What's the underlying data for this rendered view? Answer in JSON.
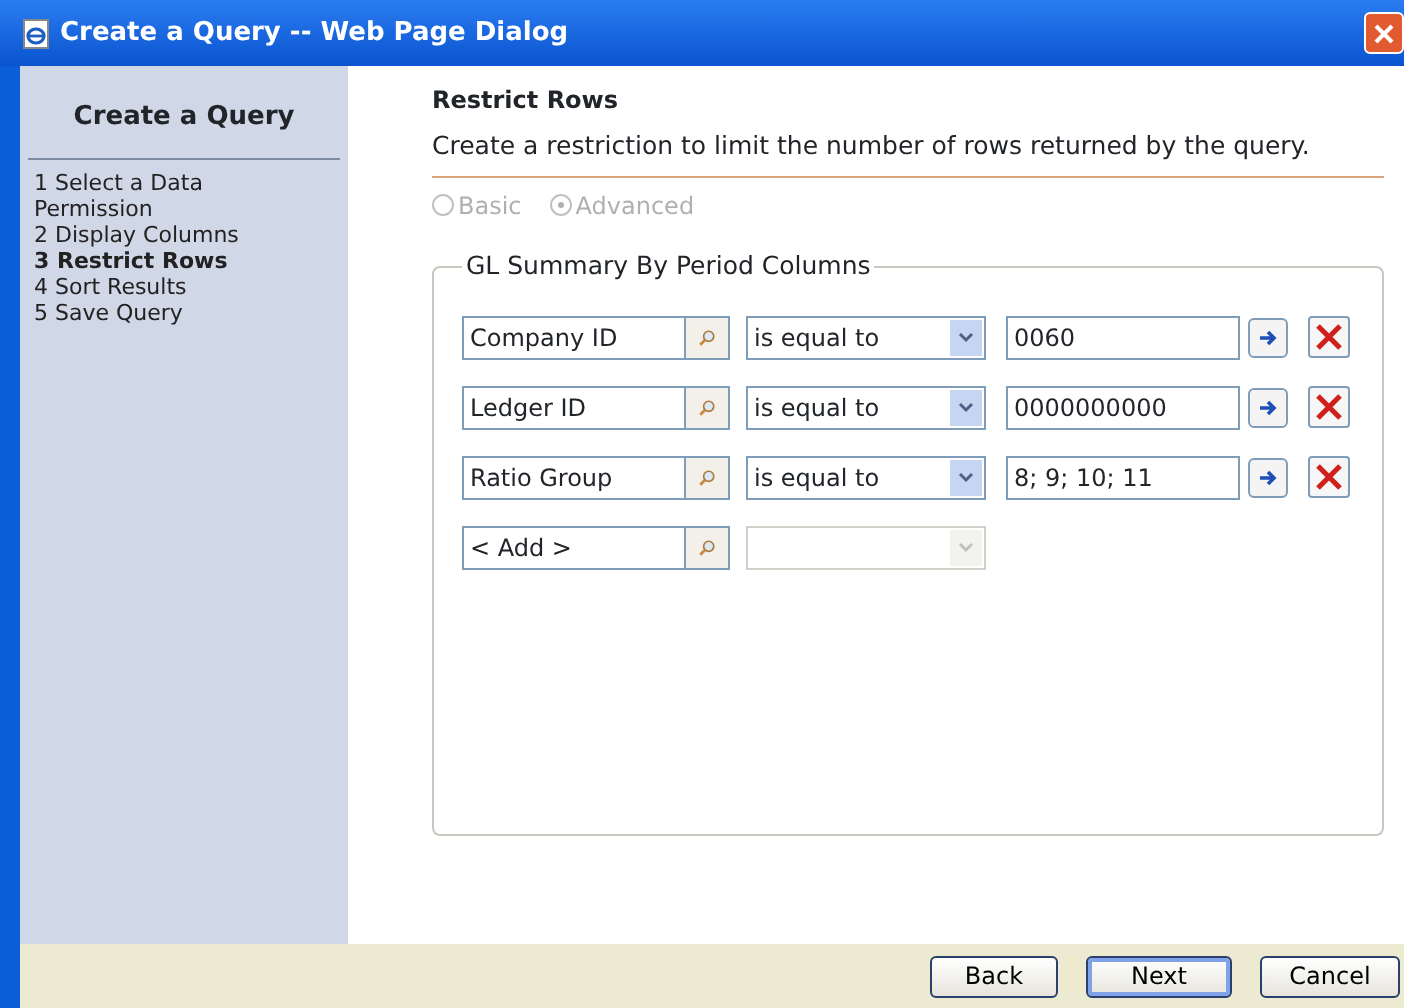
{
  "window": {
    "title": "Create a Query -- Web Page Dialog"
  },
  "sidebar": {
    "title": "Create a Query",
    "steps": [
      {
        "label": "1 Select a Data Permission",
        "selected": false
      },
      {
        "label": "2 Display Columns",
        "selected": false
      },
      {
        "label": "3 Restrict Rows",
        "selected": true
      },
      {
        "label": "4 Sort Results",
        "selected": false
      },
      {
        "label": "5 Save Query",
        "selected": false
      }
    ]
  },
  "heading": "Restrict Rows",
  "description": "Create a restriction to limit the number of rows returned by the query.",
  "mode_options": [
    {
      "label": "Basic",
      "selected": false,
      "disabled": true
    },
    {
      "label": "Advanced",
      "selected": true,
      "disabled": true
    }
  ],
  "fieldset": {
    "legend": "GL Summary By Period Columns",
    "rows": [
      {
        "kind": "criterion",
        "field": "Company ID",
        "operator": "is equal to",
        "value": "0060"
      },
      {
        "kind": "criterion",
        "field": "Ledger ID",
        "operator": "is equal to",
        "value": "0000000000"
      },
      {
        "kind": "criterion",
        "field": "Ratio Group",
        "operator": "is equal to",
        "value": "8; 9; 10; 11"
      },
      {
        "kind": "add",
        "field": "< Add >"
      }
    ]
  },
  "buttons": [
    {
      "label": "Back",
      "default": false
    },
    {
      "label": "Next",
      "default": true
    },
    {
      "label": "Cancel",
      "default": false
    }
  ]
}
